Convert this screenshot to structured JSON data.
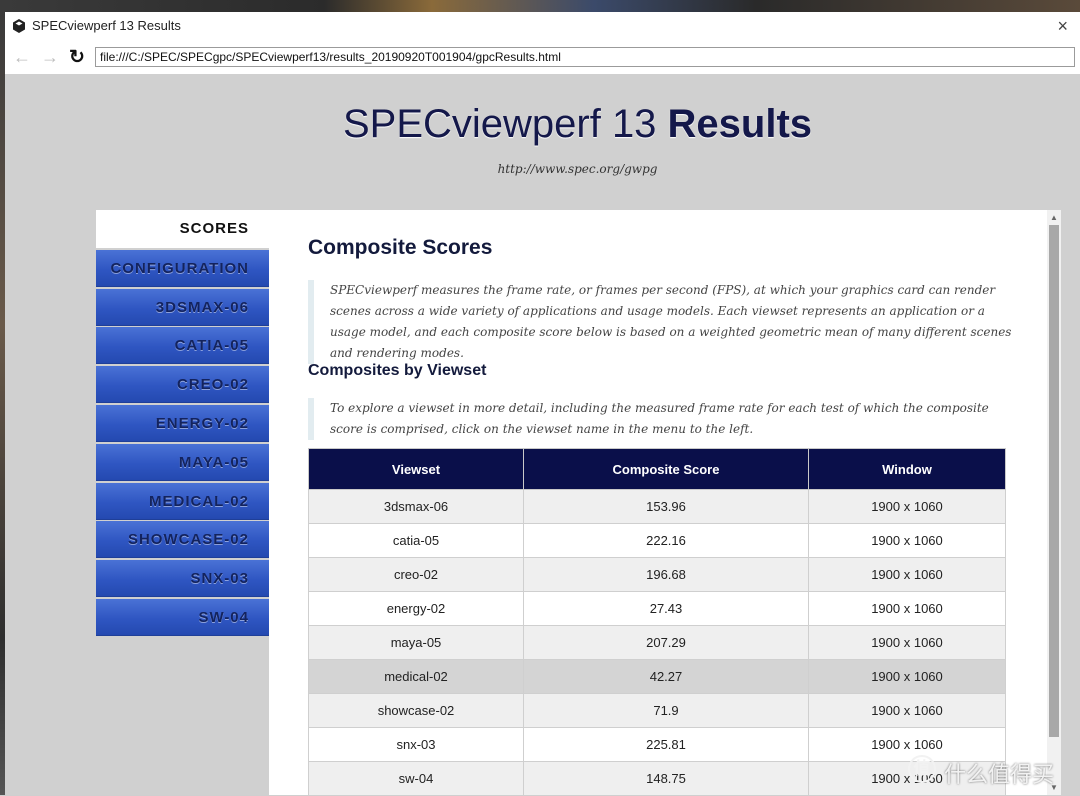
{
  "browser": {
    "window_title": "SPECviewperf 13 Results",
    "close_glyph": "×",
    "back_icon": "←",
    "forward_icon": "→",
    "reload_icon": "↻",
    "url": "file:///C:/SPEC/SPECgpc/SPECviewperf13/results_20190920T001904/gpcResults.html"
  },
  "page": {
    "title_regular": "SPECviewperf 13 ",
    "title_bold": "Results",
    "subtitle": "http://www.spec.org/gwpg"
  },
  "sidebar": {
    "items": [
      {
        "label": "SCORES",
        "active": true
      },
      {
        "label": "CONFIGURATION"
      },
      {
        "label": "3DSMAX-06"
      },
      {
        "label": "CATIA-05"
      },
      {
        "label": "CREO-02"
      },
      {
        "label": "ENERGY-02"
      },
      {
        "label": "MAYA-05"
      },
      {
        "label": "MEDICAL-02"
      },
      {
        "label": "SHOWCASE-02"
      },
      {
        "label": "SNX-03"
      },
      {
        "label": "SW-04"
      }
    ]
  },
  "main": {
    "heading": "Composite Scores",
    "intro": "SPECviewperf measures the frame rate, or frames per second (FPS), at which your graphics card can render scenes across a wide variety of applications and usage models. Each viewset represents an application or a usage model, and each composite score below is based on a weighted geometric mean of many different scenes and rendering modes.",
    "subheading": "Composites by Viewset",
    "note": "To explore a viewset in more detail, including the measured frame rate for each test of which the composite score is comprised, click on the viewset name in the menu to the left.",
    "table": {
      "headers": [
        "Viewset",
        "Composite Score",
        "Window"
      ],
      "rows": [
        [
          "3dsmax-06",
          "153.96",
          "1900 x 1060"
        ],
        [
          "catia-05",
          "222.16",
          "1900 x 1060"
        ],
        [
          "creo-02",
          "196.68",
          "1900 x 1060"
        ],
        [
          "energy-02",
          "27.43",
          "1900 x 1060"
        ],
        [
          "maya-05",
          "207.29",
          "1900 x 1060"
        ],
        [
          "medical-02",
          "42.27",
          "1900 x 1060"
        ],
        [
          "showcase-02",
          "71.9",
          "1900 x 1060"
        ],
        [
          "snx-03",
          "225.81",
          "1900 x 1060"
        ],
        [
          "sw-04",
          "148.75",
          "1900 x 1060"
        ]
      ]
    }
  },
  "watermark": {
    "logo_glyph": "值",
    "text": "什么值得买"
  },
  "colors": {
    "nav_blue": "#2f56c2",
    "table_header": "#0a0f4a",
    "title_navy": "#14184a"
  }
}
